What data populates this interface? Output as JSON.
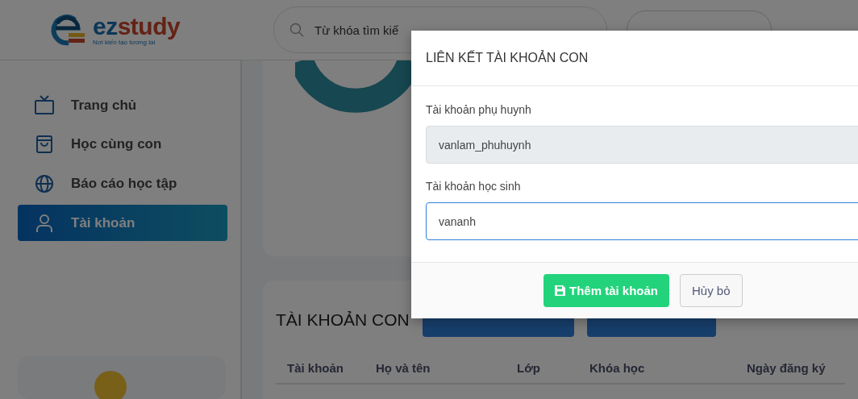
{
  "header": {
    "logo": {
      "brand": [
        "ez",
        "study"
      ],
      "tagline": "Nơi kiến tạo tương lai"
    },
    "search": {
      "placeholder": "Từ khóa tìm kiế"
    }
  },
  "sidebar": {
    "items": [
      {
        "label": "Trang chủ",
        "kind": "home",
        "selected": false
      },
      {
        "label": "Học cùng con",
        "kind": "learn",
        "selected": false
      },
      {
        "label": "Báo cáo học tập",
        "kind": "report",
        "selected": false
      },
      {
        "label": "Tài khoản",
        "kind": "account",
        "selected": true
      }
    ]
  },
  "section": {
    "title": "TÀI KHOẢN CON",
    "table": {
      "columns": [
        "Tài khoản",
        "Họ và tên",
        "Lớp",
        "Khóa học",
        "Ngày đăng ký"
      ]
    }
  },
  "modal": {
    "title": "LIÊN KẾT TÀI KHOẢN CON",
    "fields": [
      {
        "label": "Tài khoản phụ huynh",
        "value": "vanlam_phuhuynh",
        "disabled": true
      },
      {
        "label": "Tài khoản học sinh",
        "value": "vananh",
        "disabled": false
      }
    ],
    "buttons": [
      {
        "label": "Thêm tài khoản",
        "kind": "primary"
      },
      {
        "label": "Hủy bỏ",
        "kind": "secondary"
      }
    ]
  }
}
